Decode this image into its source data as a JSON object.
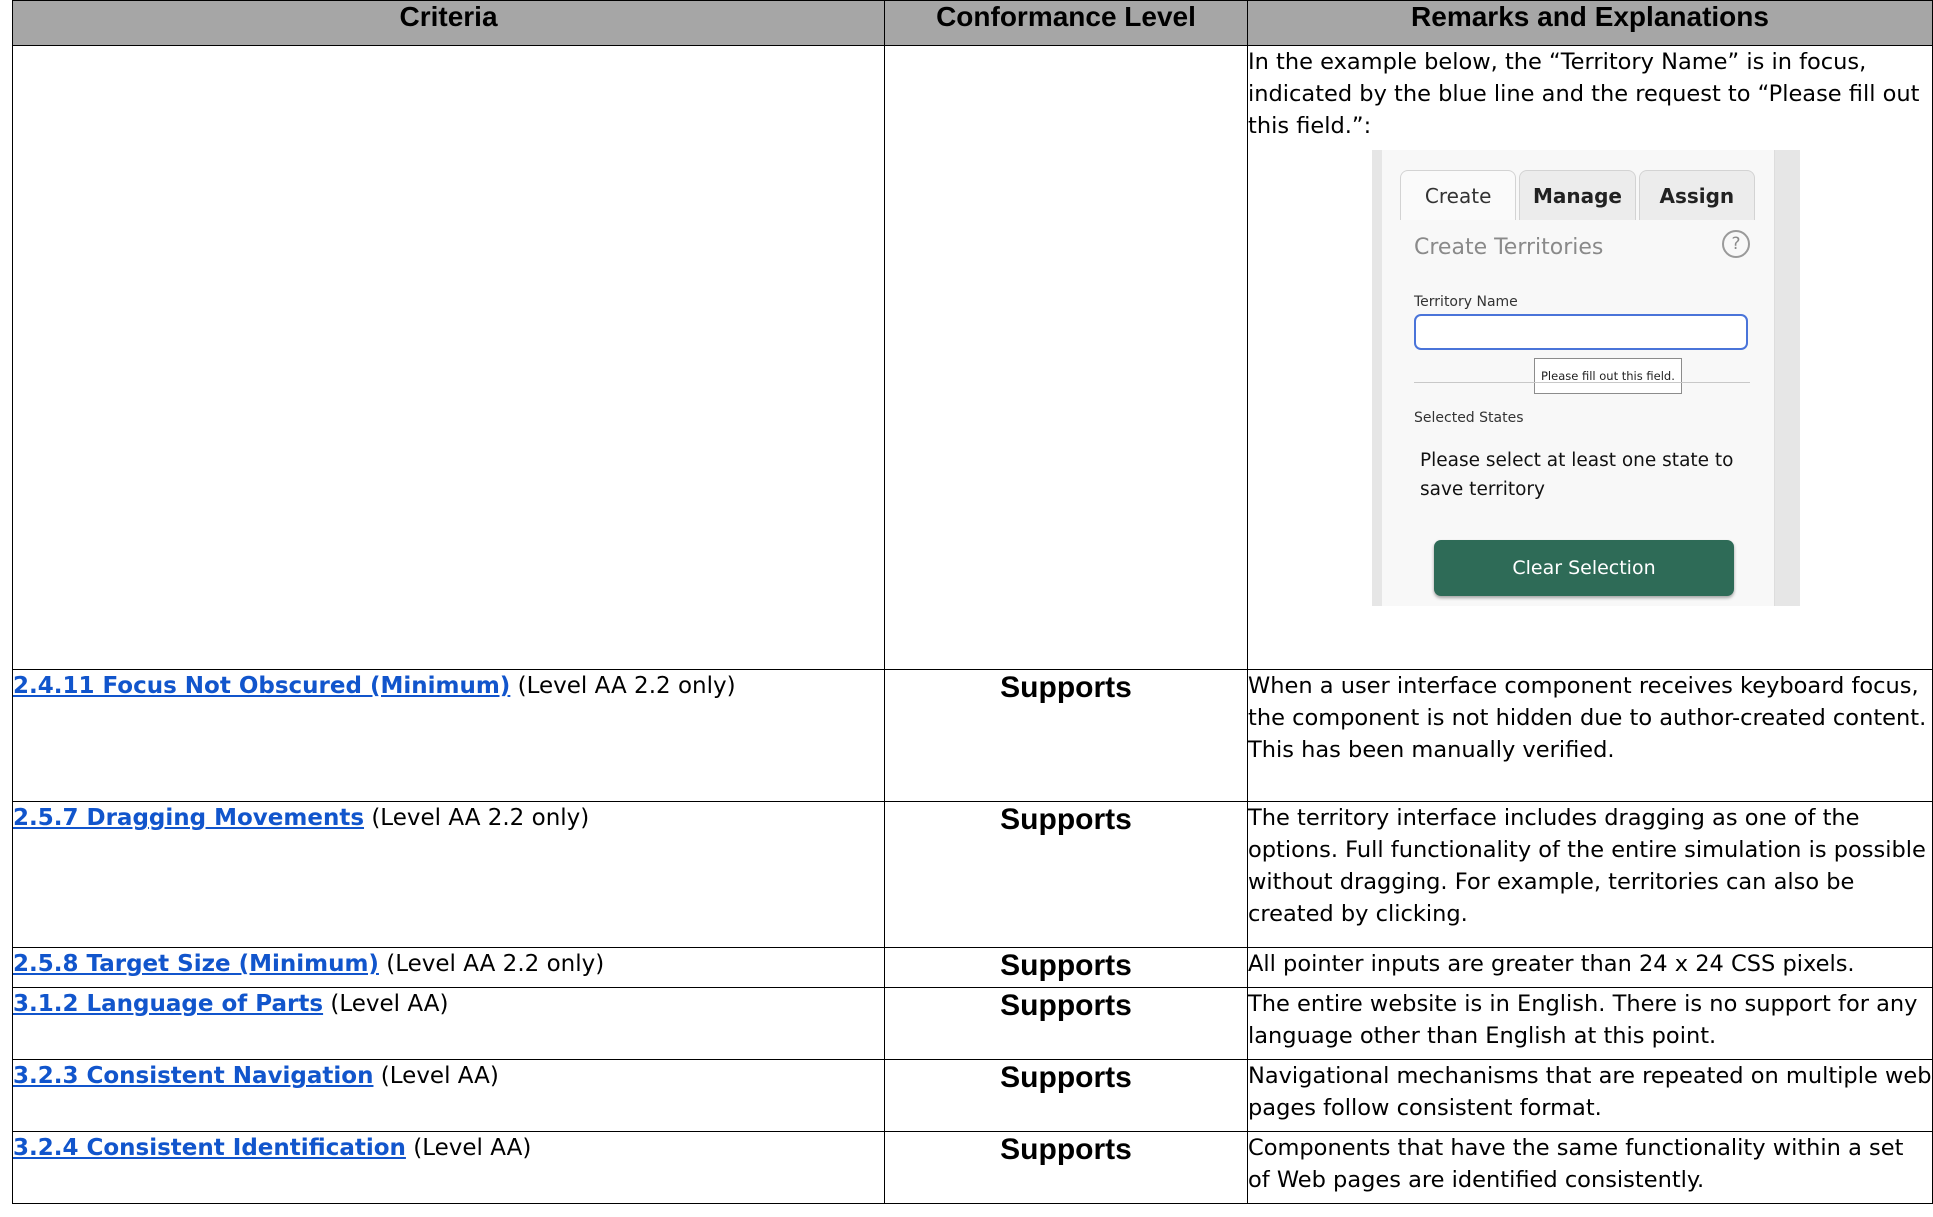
{
  "headers": {
    "criteria": "Criteria",
    "conformance": "Conformance Level",
    "remarks": "Remarks and Explanations"
  },
  "continued_row": {
    "remarks_text": "In the example below, the “Territory Name” is in focus, indicated by the blue line and the request to “Please fill out this field.”:",
    "illustration": {
      "tabs": [
        "Create",
        "Manage",
        "Assign"
      ],
      "panel_title": "Create Territories",
      "help_icon": "?",
      "field_label": "Territory Name",
      "tooltip": "Please fill out this field.",
      "states_label": "Selected States",
      "states_message": "Please select at least one state to save territory",
      "clear_button": "Clear Selection",
      "colors": {
        "focus_border": "#4a74d9",
        "button_bg": "#2e6b57"
      }
    }
  },
  "rows": [
    {
      "link": "2.4.11 Focus Not Obscured (Minimum)",
      "suffix": " (Level AA 2.2 only)",
      "level": "Supports",
      "remarks": "When a user interface component receives keyboard focus, the component is not hidden due to author-created content.  This has been manually verified."
    },
    {
      "link": "2.5.7 Dragging Movements",
      "suffix": " (Level AA 2.2 only)",
      "level": "Supports",
      "remarks": "The territory interface includes dragging as one of the options.  Full functionality of the entire simulation is possible without dragging.  For example, territories can also be created by clicking."
    },
    {
      "link": "2.5.8 Target Size (Minimum)",
      "suffix": " (Level AA 2.2 only)",
      "level": "Supports",
      "remarks": "All pointer inputs are greater than 24 x 24 CSS pixels."
    },
    {
      "link": "3.1.2 Language of Parts",
      "suffix": " (Level AA)",
      "level": "Supports",
      "remarks": "The entire website is in English.  There is no support for any language other than English at this point."
    },
    {
      "link": "3.2.3 Consistent Navigation",
      "suffix": " (Level AA)",
      "level": "Supports",
      "remarks": "Navigational mechanisms that are repeated on multiple web pages follow consistent format."
    },
    {
      "link": "3.2.4 Consistent Identification",
      "suffix": " (Level AA)",
      "level": "Supports",
      "remarks": "Components that have the same functionality within a set of Web pages are identified consistently."
    }
  ]
}
